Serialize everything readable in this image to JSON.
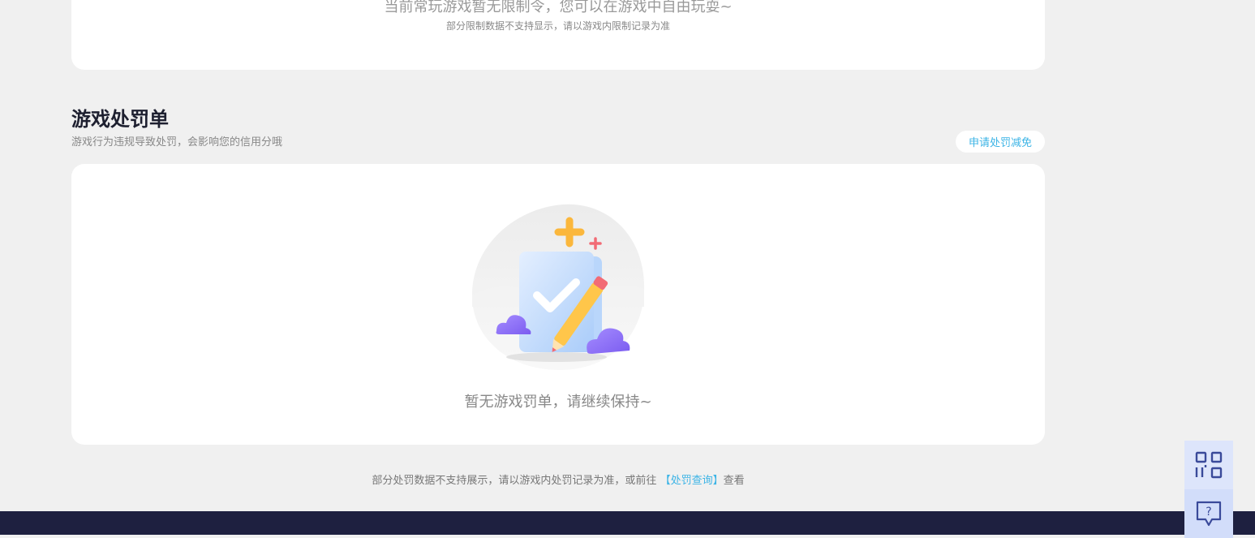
{
  "limit_card": {
    "main_text": "当前常玩游戏暂无限制令，您可以在游戏中自由玩耍~",
    "sub_text": "部分限制数据不支持显示，请以游戏内限制记录为准"
  },
  "penalty_section": {
    "title": "游戏处罚单",
    "subtitle": "游戏行为违规导致处罚，会影响您的信用分哦",
    "appeal_button": "申请处罚减免",
    "empty_text": "暂无游戏罚单，请继续保持~"
  },
  "bottom_note": {
    "prefix": "部分处罚数据不支持展示，请以游戏内处罚记录为准，或前往",
    "link": "【处罚查询】",
    "suffix": "查看"
  },
  "colors": {
    "accent": "#3cb4e6",
    "page_bg": "#f0f0f0",
    "footer_bg": "#1e2040",
    "float_bg": "#dde5fb"
  },
  "icons": {
    "qr": "qr-code-icon",
    "help": "help-chat-icon",
    "empty": "empty-penalty-illustration"
  }
}
